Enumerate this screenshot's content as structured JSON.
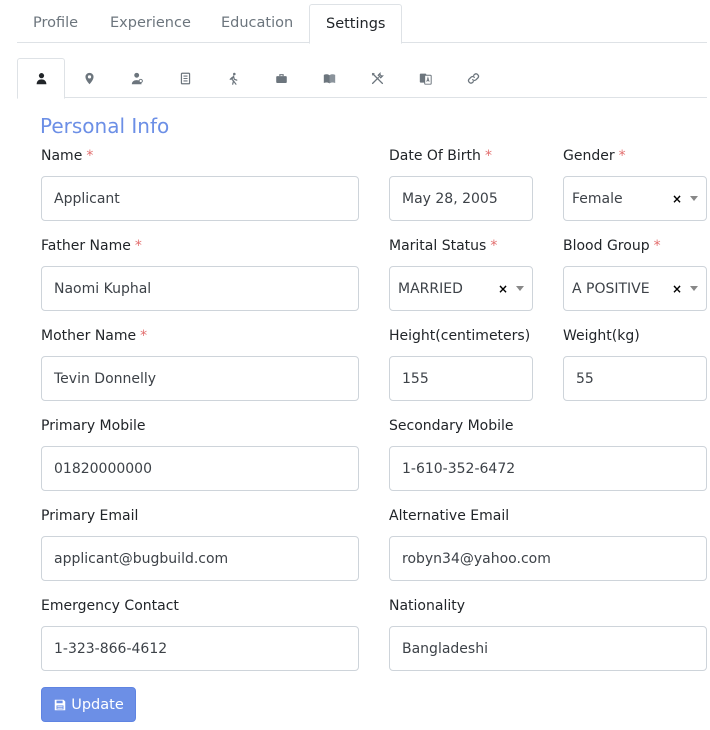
{
  "main_tabs": [
    {
      "label": "Profile"
    },
    {
      "label": "Experience"
    },
    {
      "label": "Education"
    },
    {
      "label": "Settings"
    }
  ],
  "icon_tabs": [
    "user-icon",
    "map-pin-icon",
    "user-cog-icon",
    "file-icon",
    "walking-icon",
    "briefcase-icon",
    "book-icon",
    "tools-icon",
    "language-icon",
    "link-icon"
  ],
  "section_title": "Personal Info",
  "fields": {
    "name": {
      "label": "Name",
      "value": "Applicant"
    },
    "dob": {
      "label": "Date Of Birth",
      "value": "May 28, 2005"
    },
    "gender": {
      "label": "Gender",
      "value": "Female"
    },
    "father": {
      "label": "Father Name",
      "value": "Naomi Kuphal"
    },
    "marital": {
      "label": "Marital Status",
      "value": "MARRIED"
    },
    "blood": {
      "label": "Blood Group",
      "value": "A POSITIVE"
    },
    "mother": {
      "label": "Mother Name",
      "value": "Tevin Donnelly"
    },
    "height": {
      "label": "Height(centimeters)",
      "value": "155"
    },
    "weight": {
      "label": "Weight(kg)",
      "value": "55"
    },
    "primary_mobile": {
      "label": "Primary Mobile",
      "value": "01820000000"
    },
    "secondary_mobile": {
      "label": "Secondary Mobile",
      "value": "1-610-352-6472"
    },
    "primary_email": {
      "label": "Primary Email",
      "value": "applicant@bugbuild.com"
    },
    "alt_email": {
      "label": "Alternative Email",
      "value": "robyn34@yahoo.com"
    },
    "emergency": {
      "label": "Emergency Contact",
      "value": "1-323-866-4612"
    },
    "nationality": {
      "label": "Nationality",
      "value": "Bangladeshi"
    }
  },
  "required_mark": "*",
  "clear_glyph": "×",
  "update_button": "Update",
  "colors": {
    "accent": "#6c8fe6",
    "required": "#e26d6d"
  }
}
